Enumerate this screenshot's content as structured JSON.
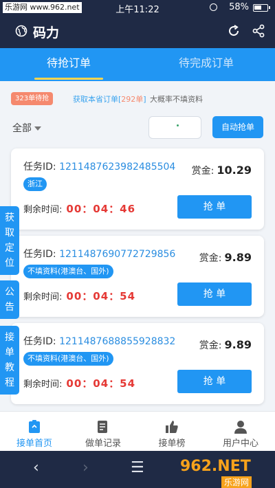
{
  "status_bar": {
    "site": "乐游网 www.962.net",
    "time": "上午11:22",
    "battery": "58%"
  },
  "header": {
    "title": "码力"
  },
  "tabs": [
    {
      "label": "待抢订单",
      "active": true
    },
    {
      "label": "待完成订单",
      "active": false
    }
  ],
  "info": {
    "count_badge": "323单待抢",
    "fetch_prefix": "获取本省订单[",
    "fetch_num": "292单",
    "fetch_suffix": "]",
    "hint": "大概率不填资料"
  },
  "filter": {
    "select_value": "全部",
    "auto_grab": "自动抢单"
  },
  "orders": [
    {
      "task_label": "任务ID:",
      "task_id": "1211487623982485504",
      "region": "浙江",
      "bounty_label": "赏金:",
      "bounty": "10.29",
      "remain_label": "剩余时间:",
      "countdown": "00：04：46",
      "grab": "抢 单"
    },
    {
      "task_label": "任务ID:",
      "task_id": "1211487690772729856",
      "region": "不填资料(港澳台、国外)",
      "bounty_label": "赏金:",
      "bounty": "9.89",
      "remain_label": "剩余时间:",
      "countdown": "00：04：54",
      "grab": "抢 单"
    },
    {
      "task_label": "任务ID:",
      "task_id": "1211487688855928832",
      "region": "不填资料(港澳台、国外)",
      "bounty_label": "赏金:",
      "bounty": "9.89",
      "remain_label": "剩余时间:",
      "countdown": "00：04：54",
      "grab": "抢 单"
    }
  ],
  "side_tabs": [
    {
      "label": "获取定位"
    },
    {
      "label": "公告"
    },
    {
      "label": "接单教程"
    }
  ],
  "bottom_nav": [
    {
      "label": "接单首页",
      "icon": "home-clipboard-icon",
      "active": true
    },
    {
      "label": "做单记录",
      "icon": "record-icon",
      "active": false
    },
    {
      "label": "接单榜",
      "icon": "thumbs-up-icon",
      "active": false
    },
    {
      "label": "用户中心",
      "icon": "user-icon",
      "active": false
    }
  ],
  "watermark": {
    "top": "962.NET",
    "bottom": "乐游网"
  },
  "colors": {
    "header": "#1f2a45",
    "accent": "#2196f3",
    "countdown": "#e53935",
    "badge": "#f5896e"
  }
}
